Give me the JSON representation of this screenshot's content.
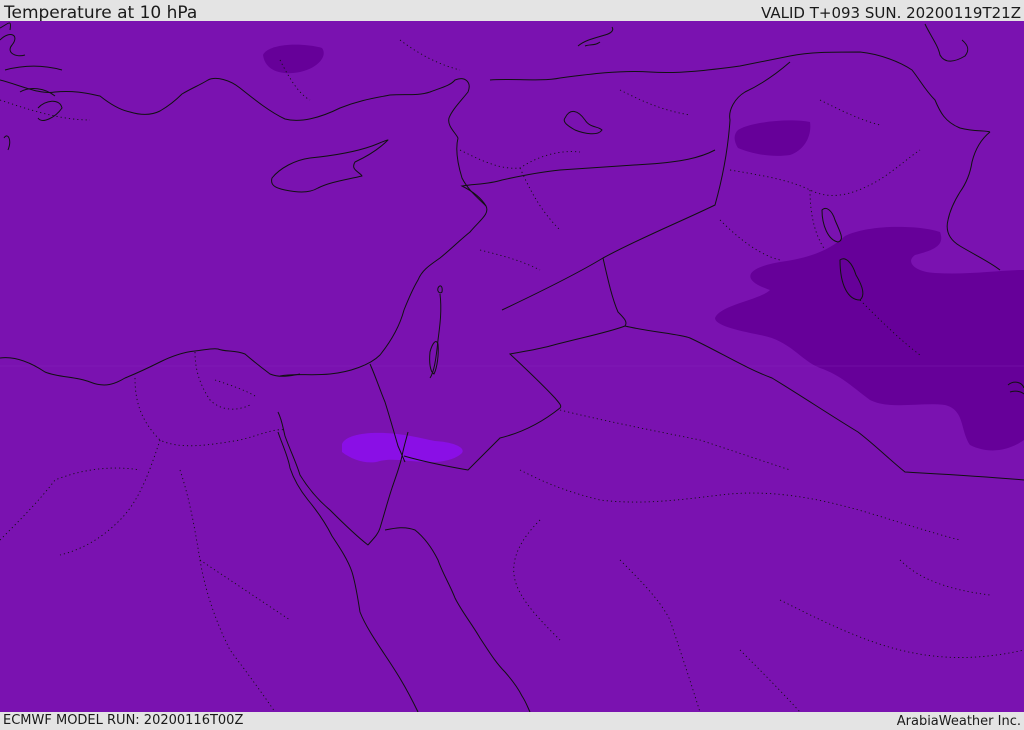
{
  "header": {
    "title": "Temperature at 10 hPa",
    "valid_time": "VALID T+093 SUN. 20200119T21Z"
  },
  "footer": {
    "model_run": "ECMWF MODEL RUN: 20200116T00Z",
    "credit": "ArabiaWeather Inc."
  },
  "map": {
    "colors": {
      "base_field": "#7a12b0",
      "cold_pocket": "#660099",
      "warm_pocket": "#8a0fe6",
      "lines": "#111111"
    }
  }
}
